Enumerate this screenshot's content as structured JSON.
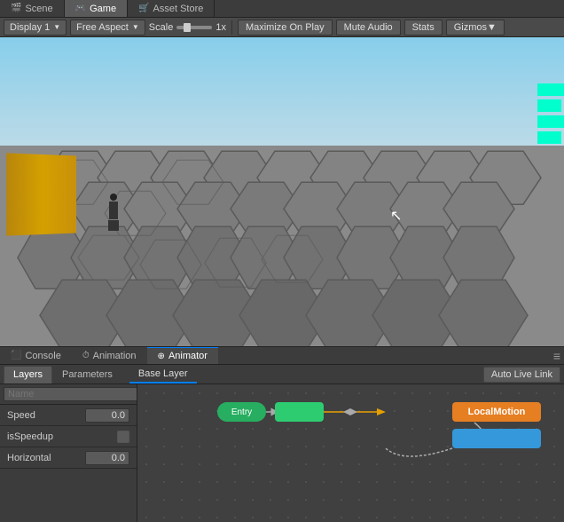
{
  "top_tabs": [
    {
      "label": "Scene",
      "icon": "🎬",
      "active": false
    },
    {
      "label": "Game",
      "icon": "🎮",
      "active": true
    },
    {
      "label": "Asset Store",
      "icon": "🛒",
      "active": false
    }
  ],
  "toolbar": {
    "display_label": "Display 1",
    "aspect_label": "Free Aspect",
    "scale_label": "Scale",
    "scale_value": "1x",
    "maximize_label": "Maximize On Play",
    "mute_label": "Mute Audio",
    "stats_label": "Stats",
    "gizmos_label": "Gizmos"
  },
  "bottom_tabs": [
    {
      "label": "Console",
      "icon": "⬛",
      "active": false
    },
    {
      "label": "Animation",
      "icon": "⏱",
      "active": false
    },
    {
      "label": "Animator",
      "icon": "⊕",
      "active": true
    }
  ],
  "animator_sub_tabs": [
    {
      "label": "Layers",
      "active": true
    },
    {
      "label": "Parameters",
      "active": false
    }
  ],
  "base_layer_label": "Base Layer",
  "auto_live_link_label": "Auto Live Link",
  "param_search_placeholder": "Name",
  "parameters": [
    {
      "name": "Speed",
      "value": "0.0",
      "type": "float"
    },
    {
      "name": "isSpeedup",
      "value": "",
      "type": "checkbox"
    },
    {
      "name": "Horizontal",
      "value": "0.0",
      "type": "float"
    }
  ],
  "state_nodes": [
    {
      "label": "Entry",
      "type": "entry"
    },
    {
      "label": "",
      "type": "green"
    },
    {
      "label": "LocalMotion",
      "type": "orange"
    },
    {
      "label": "",
      "type": "blue"
    }
  ],
  "panel_options_icon": "≡"
}
